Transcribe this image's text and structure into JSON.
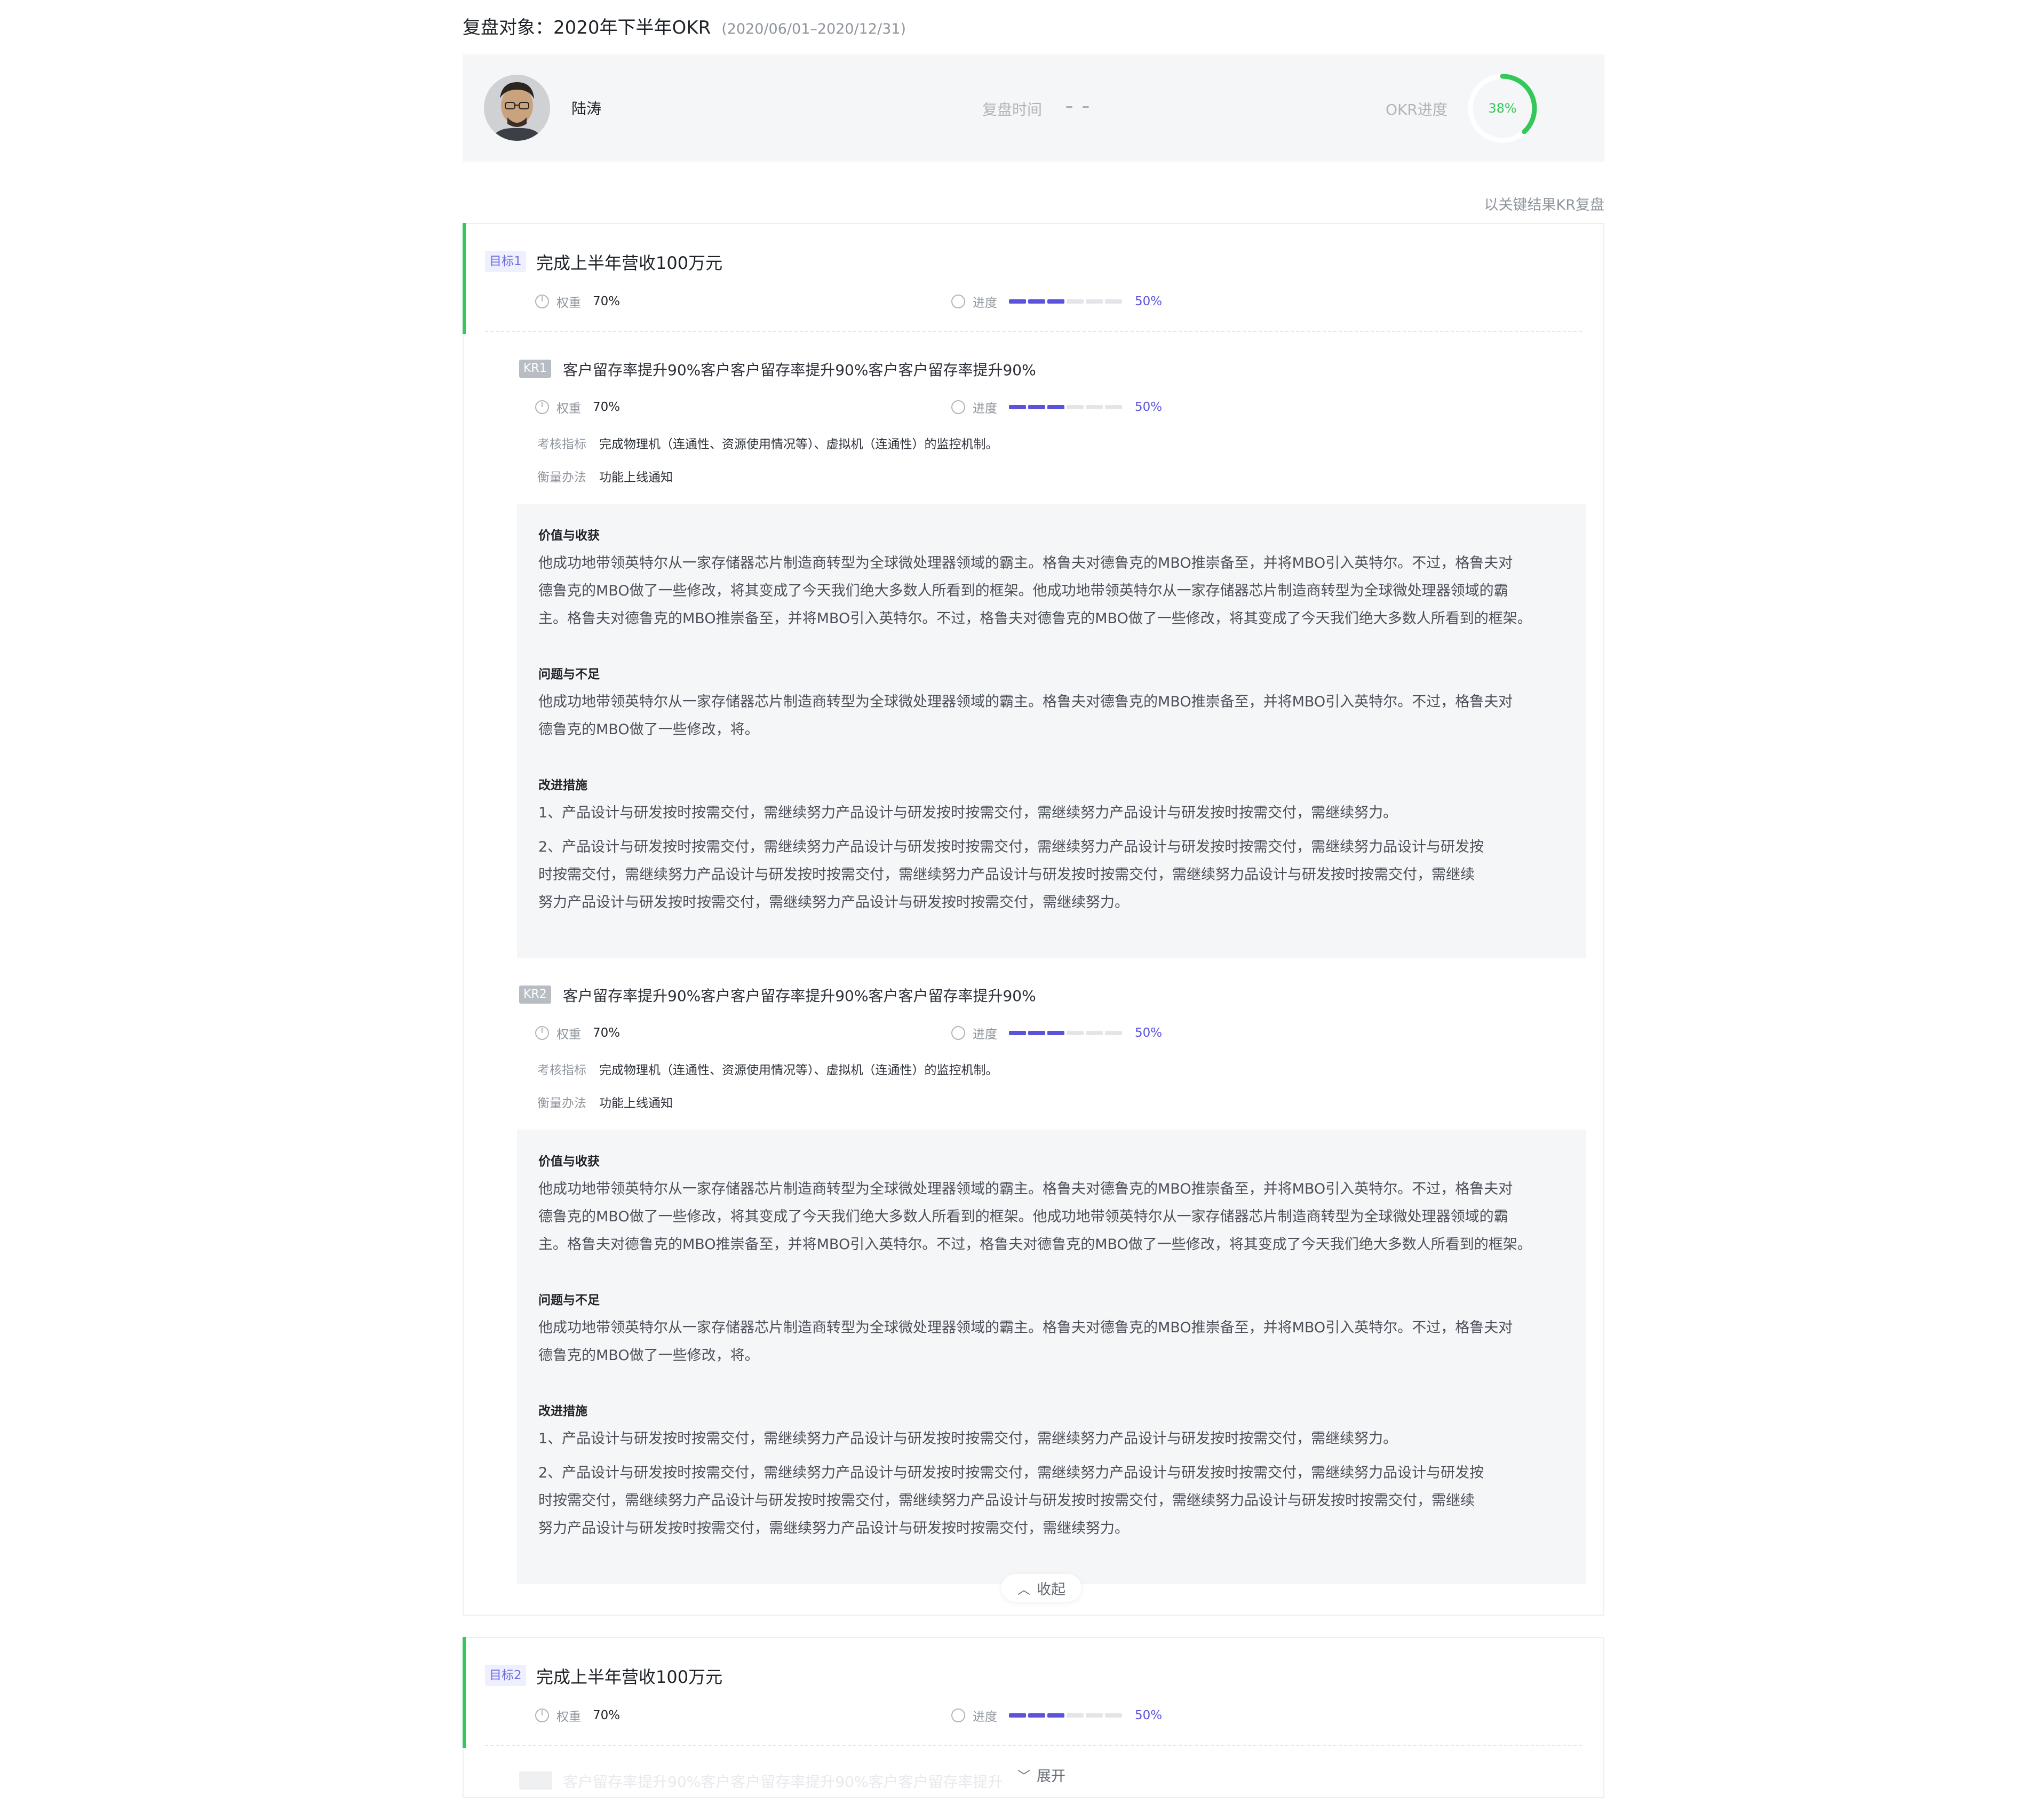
{
  "page": {
    "title": "复盘对象：2020年下半年OKR",
    "date_range": "(2020/06/01–2020/12/31)"
  },
  "summary": {
    "person_name": "陆涛",
    "review_time_label": "复盘时间",
    "review_time_value": "– –",
    "okr_progress_label": "OKR进度",
    "okr_progress_text": "38%",
    "okr_progress": 0.38,
    "ring_color": "#34c759"
  },
  "kr_mode_link": "以关键结果KR复盘",
  "labels": {
    "weight": "权重",
    "progress": "进度",
    "indicator": "考核指标",
    "method": "衡量办法",
    "value_gain": "价值与收获",
    "problems": "问题与不足",
    "improvements": "改进措施"
  },
  "colors": {
    "accent_green": "#34c759",
    "progress_purple": "#5b52e0",
    "tag_purple_bg": "#eff0ff"
  },
  "objectives": [
    {
      "tag": "目标1",
      "title": "完成上半年营收100万元",
      "weight": "70%",
      "progress_text": "50%",
      "progress": 0.5,
      "krs": [
        {
          "tag": "KR1",
          "title": "客户留存率提升90%客户客户留存率提升90%客户客户留存率提升90%",
          "weight": "70%",
          "progress_text": "50%",
          "indicator": "完成物理机（连通性、资源使用情况等）、虚拟机（连通性）的监控机制。",
          "method": "功能上线通知",
          "value_gain": [
            "他成功地带领英特尔从一家存储器芯片制造商转型为全球微处理器领域的霸主。格鲁夫对德鲁克的MBO推崇备至，并将MBO引入英特尔。不过，格鲁夫对",
            "德鲁克的MBO做了一些修改，将其变成了今天我们绝大多数人所看到的框架。他成功地带领英特尔从一家存储器芯片制造商转型为全球微处理器领域的霸",
            "主。格鲁夫对德鲁克的MBO推崇备至，并将MBO引入英特尔。不过，格鲁夫对德鲁克的MBO做了一些修改，将其变成了今天我们绝大多数人所看到的框架。"
          ],
          "problems": [
            "他成功地带领英特尔从一家存储器芯片制造商转型为全球微处理器领域的霸主。格鲁夫对德鲁克的MBO推崇备至，并将MBO引入英特尔。不过，格鲁夫对",
            "德鲁克的MBO做了一些修改，将。"
          ],
          "improvement_1": "1、产品设计与研发按时按需交付，需继续努力产品设计与研发按时按需交付，需继续努力产品设计与研发按时按需交付，需继续努力。",
          "improvement_2": [
            "2、产品设计与研发按时按需交付，需继续努力产品设计与研发按时按需交付，需继续努力产品设计与研发按时按需交付，需继续努力品设计与研发按",
            "时按需交付，需继续努力产品设计与研发按时按需交付，需继续努力产品设计与研发按时按需交付，需继续努力品设计与研发按时按需交付，需继续",
            "努力产品设计与研发按时按需交付，需继续努力产品设计与研发按时按需交付，需继续努力。"
          ]
        },
        {
          "tag": "KR2",
          "title": "客户留存率提升90%客户客户留存率提升90%客户客户留存率提升90%",
          "weight": "70%",
          "progress_text": "50%",
          "indicator": "完成物理机（连通性、资源使用情况等）、虚拟机（连通性）的监控机制。",
          "method": "功能上线通知",
          "value_gain": [
            "他成功地带领英特尔从一家存储器芯片制造商转型为全球微处理器领域的霸主。格鲁夫对德鲁克的MBO推崇备至，并将MBO引入英特尔。不过，格鲁夫对",
            "德鲁克的MBO做了一些修改，将其变成了今天我们绝大多数人所看到的框架。他成功地带领英特尔从一家存储器芯片制造商转型为全球微处理器领域的霸",
            "主。格鲁夫对德鲁克的MBO推崇备至，并将MBO引入英特尔。不过，格鲁夫对德鲁克的MBO做了一些修改，将其变成了今天我们绝大多数人所看到的框架。"
          ],
          "problems": [
            "他成功地带领英特尔从一家存储器芯片制造商转型为全球微处理器领域的霸主。格鲁夫对德鲁克的MBO推崇备至，并将MBO引入英特尔。不过，格鲁夫对",
            "德鲁克的MBO做了一些修改，将。"
          ],
          "improvement_1": "1、产品设计与研发按时按需交付，需继续努力产品设计与研发按时按需交付，需继续努力产品设计与研发按时按需交付，需继续努力。",
          "improvement_2": [
            "2、产品设计与研发按时按需交付，需继续努力产品设计与研发按时按需交付，需继续努力产品设计与研发按时按需交付，需继续努力品设计与研发按",
            "时按需交付，需继续努力产品设计与研发按时按需交付，需继续努力产品设计与研发按时按需交付，需继续努力品设计与研发按时按需交付，需继续",
            "努力产品设计与研发按时按需交付，需继续努力产品设计与研发按时按需交付，需继续努力。"
          ]
        }
      ],
      "toggle_label": "收起",
      "toggle_icon": "chevron-up-icon"
    },
    {
      "tag": "目标2",
      "title": "完成上半年营收100万元",
      "weight": "70%",
      "progress_text": "50%",
      "progress": 0.5,
      "faded_kr_title": "客户留存率提升90%客户客户留存率提升90%客户客户留存率提升",
      "toggle_label": "展开",
      "toggle_icon": "chevron-down-icon"
    }
  ]
}
